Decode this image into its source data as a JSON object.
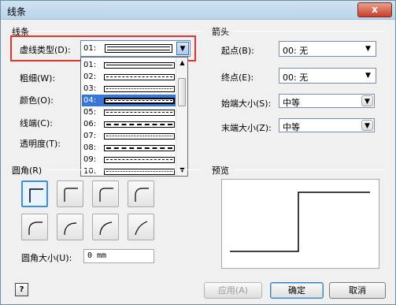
{
  "window": {
    "title": "线条",
    "close": "x"
  },
  "line": {
    "group": "线条",
    "dash_label": "虚线类型(D):",
    "dash_value": "01:",
    "weight_label": "粗细(W):",
    "color_label": "颜色(O):",
    "cap_label": "线端(C):",
    "transparency_label": "透明度(T):",
    "options": [
      "01:",
      "02:",
      "03:",
      "04:",
      "05:",
      "06:",
      "07:",
      "08:",
      "09:",
      "10:"
    ],
    "selected_index": 3
  },
  "arrows": {
    "group": "箭头",
    "begin_label": "起点(B):",
    "begin_value": "00: 无",
    "end_label": "终点(E):",
    "end_value": "00: 无",
    "begin_size_label": "始端大小(S):",
    "begin_size_value": "中等",
    "end_size_label": "末端大小(Z):",
    "end_size_value": "中等"
  },
  "corners": {
    "group": "圆角(R)",
    "size_label": "圆角大小(U):",
    "size_value": "0 mm"
  },
  "preview": {
    "group": "预览"
  },
  "buttons": {
    "help": "?",
    "apply": "应用(A)",
    "ok": "确定",
    "cancel": "取消"
  }
}
